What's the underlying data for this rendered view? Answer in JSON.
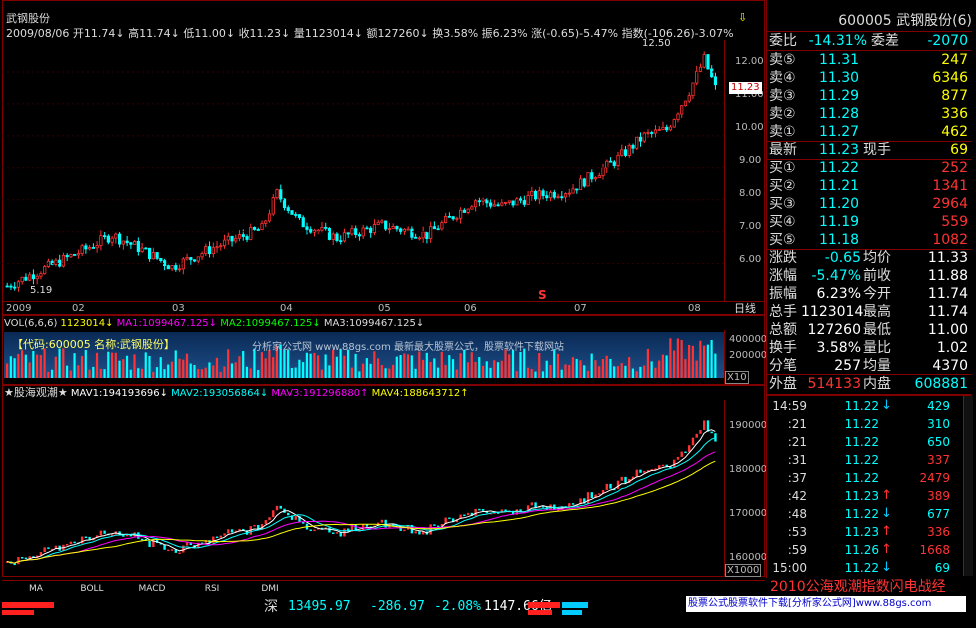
{
  "colors": {
    "up": "#ff3333",
    "down": "#00ffff",
    "ma1": "#ffffff",
    "ma2": "#ffff00",
    "ma3": "#ff00ff",
    "ma4": "#00ff00",
    "frame": "#800000",
    "yellow": "#ffff00"
  },
  "chart": {
    "stock_name": "武钢股份",
    "info": {
      "date": "2009/08/06",
      "open": "开11.74↓",
      "high": "高11.74↓",
      "low": "低11.00↓",
      "close": "收11.23↓",
      "volume": "量1123014↓",
      "amount": "额127260↓",
      "turnover": "换3.58%",
      "amplitude": "振6.23%",
      "change": "涨(-0.65)-5.47%",
      "index": "指数(-106.26)-3.07%"
    },
    "high_label": "12.50",
    "low_label": "5.19",
    "current_label": "11.23",
    "marker": "S",
    "y_ticks": [
      "12.00",
      "11.00",
      "10.00",
      "9.00",
      "8.00",
      "7.00",
      "6.00"
    ],
    "x_labels": [
      "2009",
      "02",
      "03",
      "04",
      "05",
      "06",
      "07",
      "08"
    ],
    "period_label": "日线"
  },
  "volume": {
    "title": "VOL(6,6,6)",
    "vol": "1123014↓",
    "ma1": "MA1:1099467.125↓",
    "ma2": "MA2:1099467.125↓",
    "ma3": "MA3:1099467.125↓",
    "banner": "【代码:600005 名称:武钢股份】",
    "watermark": "分析家公式网 www.88gs.com 最新最大股票公式，股票软件下载网站",
    "y_ticks": [
      "400000",
      "200000"
    ],
    "unit": "X10"
  },
  "indicator": {
    "title": "★股海观潮★",
    "mav1": "MAV1:194193696↓",
    "mav2": "MAV2:193056864↓",
    "mav3": "MAV3:191296880↑",
    "mav4": "MAV4:188643712↑",
    "y_ticks": [
      "190000",
      "180000",
      "170000",
      "160000"
    ],
    "unit": "X1000"
  },
  "tabs": [
    "MA",
    "BOLL",
    "MACD",
    "RSI",
    "DMI"
  ],
  "status": {
    "market": "深",
    "index": "13495.97",
    "change": "-286.97",
    "pct": "-2.08%",
    "amount": "1147.66亿",
    "promo": "股票公式股票软件下载[分析家公式网]www.88gs.com",
    "scroll_text": "2010公海观潮指数闪电战经"
  },
  "quote": {
    "code_name": "600005 武钢股份(6)",
    "weibi": {
      "label": "委比",
      "value": "-14.31%",
      "label2": "委差",
      "value2": "-2070"
    },
    "sells": [
      {
        "label": "卖⑤",
        "price": "11.31",
        "vol": "247"
      },
      {
        "label": "卖④",
        "price": "11.30",
        "vol": "6346"
      },
      {
        "label": "卖③",
        "price": "11.29",
        "vol": "877"
      },
      {
        "label": "卖②",
        "price": "11.28",
        "vol": "336"
      },
      {
        "label": "卖①",
        "price": "11.27",
        "vol": "462"
      }
    ],
    "latest": {
      "label": "最新",
      "price": "11.23",
      "label2": "现手",
      "value2": "69"
    },
    "buys": [
      {
        "label": "买①",
        "price": "11.22",
        "vol": "252"
      },
      {
        "label": "买②",
        "price": "11.21",
        "vol": "1341"
      },
      {
        "label": "买③",
        "price": "11.20",
        "vol": "2964"
      },
      {
        "label": "买④",
        "price": "11.19",
        "vol": "559"
      },
      {
        "label": "买⑤",
        "price": "11.18",
        "vol": "1082"
      }
    ],
    "stats": [
      {
        "l1": "涨跌",
        "v1": "-0.65",
        "l2": "均价",
        "v2": "11.33"
      },
      {
        "l1": "涨幅",
        "v1": "-5.47%",
        "l2": "前收",
        "v2": "11.88"
      },
      {
        "l1": "振幅",
        "v1": "6.23%",
        "l2": "今开",
        "v2": "11.74"
      },
      {
        "l1": "总手",
        "v1": "1123014",
        "l2": "最高",
        "v2": "11.74"
      },
      {
        "l1": "总额",
        "v1": "127260",
        "l2": "最低",
        "v2": "11.00"
      },
      {
        "l1": "换手",
        "v1": "3.58%",
        "l2": "量比",
        "v2": "1.02"
      },
      {
        "l1": "分笔",
        "v1": "257",
        "l2": "均量",
        "v2": "4370"
      }
    ],
    "outer": {
      "label": "外盘",
      "value": "514133",
      "label2": "内盘",
      "value2": "608881"
    },
    "ticks": [
      {
        "time": "14:59",
        "price": "11.22",
        "dir": "↓",
        "vol": "429"
      },
      {
        "time": ":21",
        "price": "11.22",
        "dir": "",
        "vol": "310"
      },
      {
        "time": ":21",
        "price": "11.22",
        "dir": "",
        "vol": "650"
      },
      {
        "time": ":31",
        "price": "11.22",
        "dir": "",
        "vol": "337"
      },
      {
        "time": ":37",
        "price": "11.22",
        "dir": "",
        "vol": "2479"
      },
      {
        "time": ":42",
        "price": "11.23",
        "dir": "↑",
        "vol": "389"
      },
      {
        "time": ":48",
        "price": "11.22",
        "dir": "↓",
        "vol": "677"
      },
      {
        "time": ":53",
        "price": "11.23",
        "dir": "↑",
        "vol": "336"
      },
      {
        "time": ":59",
        "price": "11.26",
        "dir": "↑",
        "vol": "1668"
      },
      {
        "time": "15:00",
        "price": "11.22",
        "dir": "↓",
        "vol": "69"
      }
    ]
  }
}
